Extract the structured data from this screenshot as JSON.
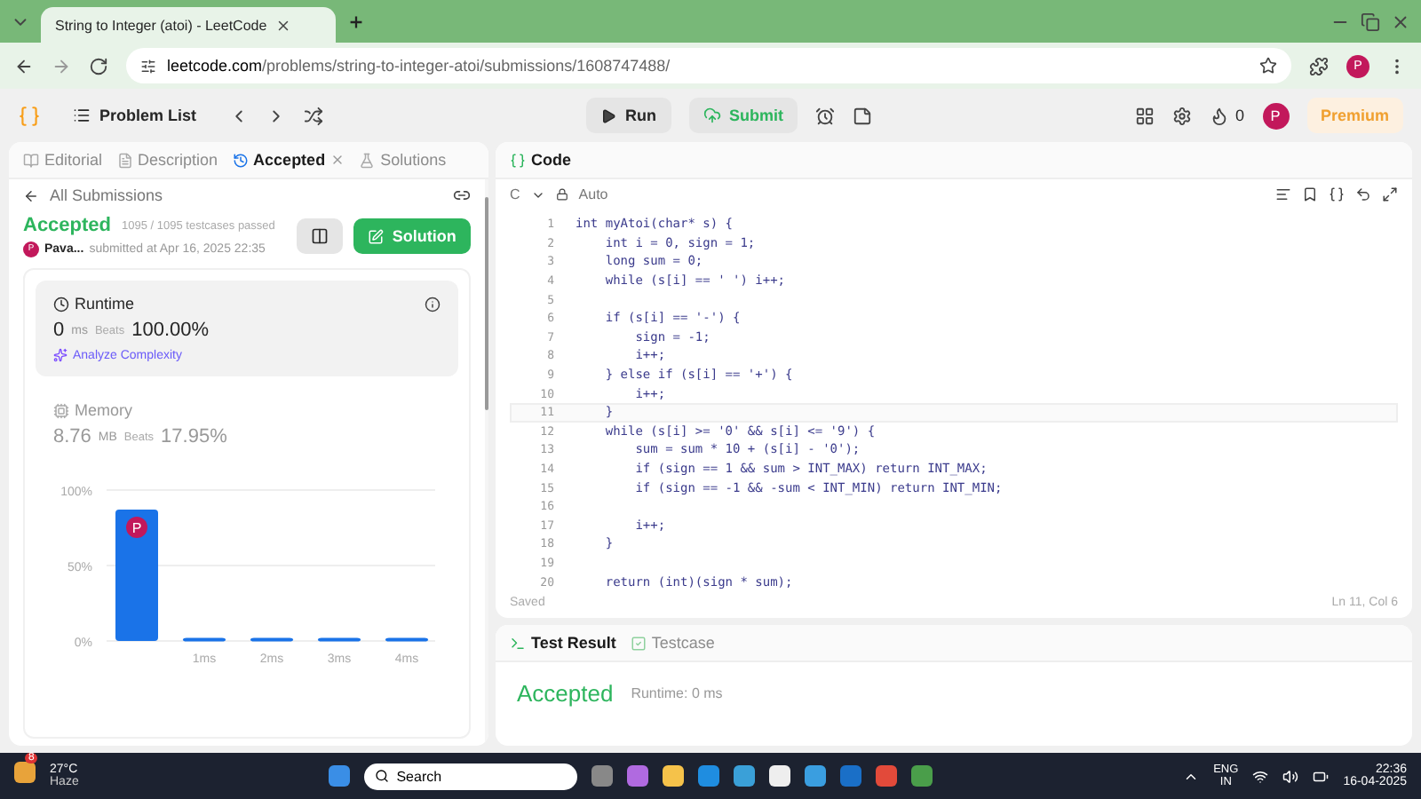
{
  "browser": {
    "tab_title": "String to Integer (atoi) - LeetCode",
    "url_host": "leetcode.com",
    "url_path": "/problems/string-to-integer-atoi/submissions/1608747488/",
    "profile": "P"
  },
  "toolbar": {
    "problem_list": "Problem List",
    "run": "Run",
    "submit": "Submit",
    "streak": "0",
    "avatar": "P",
    "premium": "Premium"
  },
  "left_tabs": [
    {
      "label": "Editorial",
      "selected": false
    },
    {
      "label": "Description",
      "selected": false
    },
    {
      "label": "Accepted",
      "selected": true
    },
    {
      "label": "Solutions",
      "selected": false
    }
  ],
  "submission": {
    "back": "All Submissions",
    "status": "Accepted",
    "tests": "1095 / 1095 testcases passed",
    "avatar": "P",
    "user": "Pava...",
    "submitted": "submitted at Apr 16, 2025 22:35",
    "solution_button": "Solution"
  },
  "metrics": [
    {
      "kind": "runtime",
      "title": "Runtime",
      "value": "0",
      "unit": "ms",
      "beats_label": "Beats",
      "beats": "100.00%",
      "link": "Analyze Complexity",
      "selected": true
    },
    {
      "kind": "memory",
      "title": "Memory",
      "value": "8.76",
      "unit": "MB",
      "beats_label": "Beats",
      "beats": "17.95%",
      "selected": false
    }
  ],
  "chart_marker": "P",
  "chart_data": {
    "type": "bar",
    "categories": [
      null,
      "1ms",
      "2ms",
      "3ms",
      "4ms"
    ],
    "values": [
      87,
      2,
      2,
      2,
      2
    ],
    "ylim": [
      0,
      100
    ],
    "yticks": [
      {
        "value": 0,
        "label": "0%"
      },
      {
        "value": 50,
        "label": "50%"
      },
      {
        "value": 100,
        "label": "100%"
      }
    ]
  },
  "editor": {
    "title": "Code",
    "language": "C",
    "mode": "Auto",
    "status": "Saved",
    "cursor": "Ln 11, Col 6",
    "lines": [
      {
        "number": "1",
        "text": "int myAtoi(char* s) {",
        "current": false
      },
      {
        "number": "2",
        "text": "    int i = 0, sign = 1;",
        "current": false
      },
      {
        "number": "3",
        "text": "    long sum = 0;",
        "current": false
      },
      {
        "number": "4",
        "text": "    while (s[i] == ' ') i++;",
        "current": false
      },
      {
        "number": "5",
        "current": false
      },
      {
        "number": "6",
        "text": "    if (s[i] == '-') {",
        "current": false
      },
      {
        "number": "7",
        "text": "        sign = -1;",
        "current": false
      },
      {
        "number": "8",
        "text": "        i++;",
        "current": false
      },
      {
        "number": "9",
        "text": "    } else if (s[i] == '+') {",
        "current": false
      },
      {
        "number": "10",
        "text": "        i++;",
        "current": false
      },
      {
        "number": "11",
        "text": "    }",
        "current": true
      },
      {
        "number": "12",
        "text": "    while (s[i] >= '0' && s[i] <= '9') {",
        "current": false
      },
      {
        "number": "13",
        "text": "        sum = sum * 10 + (s[i] - '0');",
        "current": false
      },
      {
        "number": "14",
        "text": "        if (sign == 1 && sum > INT_MAX) return INT_MAX;",
        "current": false
      },
      {
        "number": "15",
        "text": "        if (sign == -1 && -sum < INT_MIN) return INT_MIN;",
        "current": false
      },
      {
        "number": "16",
        "current": false
      },
      {
        "number": "17",
        "text": "        i++;",
        "current": false
      },
      {
        "number": "18",
        "text": "    }",
        "current": false
      },
      {
        "number": "19",
        "current": false
      },
      {
        "number": "20",
        "text": "    return (int)(sign * sum);",
        "current": false
      }
    ]
  },
  "result_tabs": [
    {
      "label": "Test Result",
      "selected": true
    },
    {
      "label": "Testcase",
      "selected": false
    }
  ],
  "result": {
    "status": "Accepted",
    "runtime": "Runtime: 0 ms"
  },
  "taskbar": {
    "temperature": "27°C",
    "weather": "Haze",
    "weather_badge": "8",
    "search": "Search",
    "language": "ENG",
    "region": "IN",
    "time": "22:36",
    "date": "16-04-2025"
  }
}
